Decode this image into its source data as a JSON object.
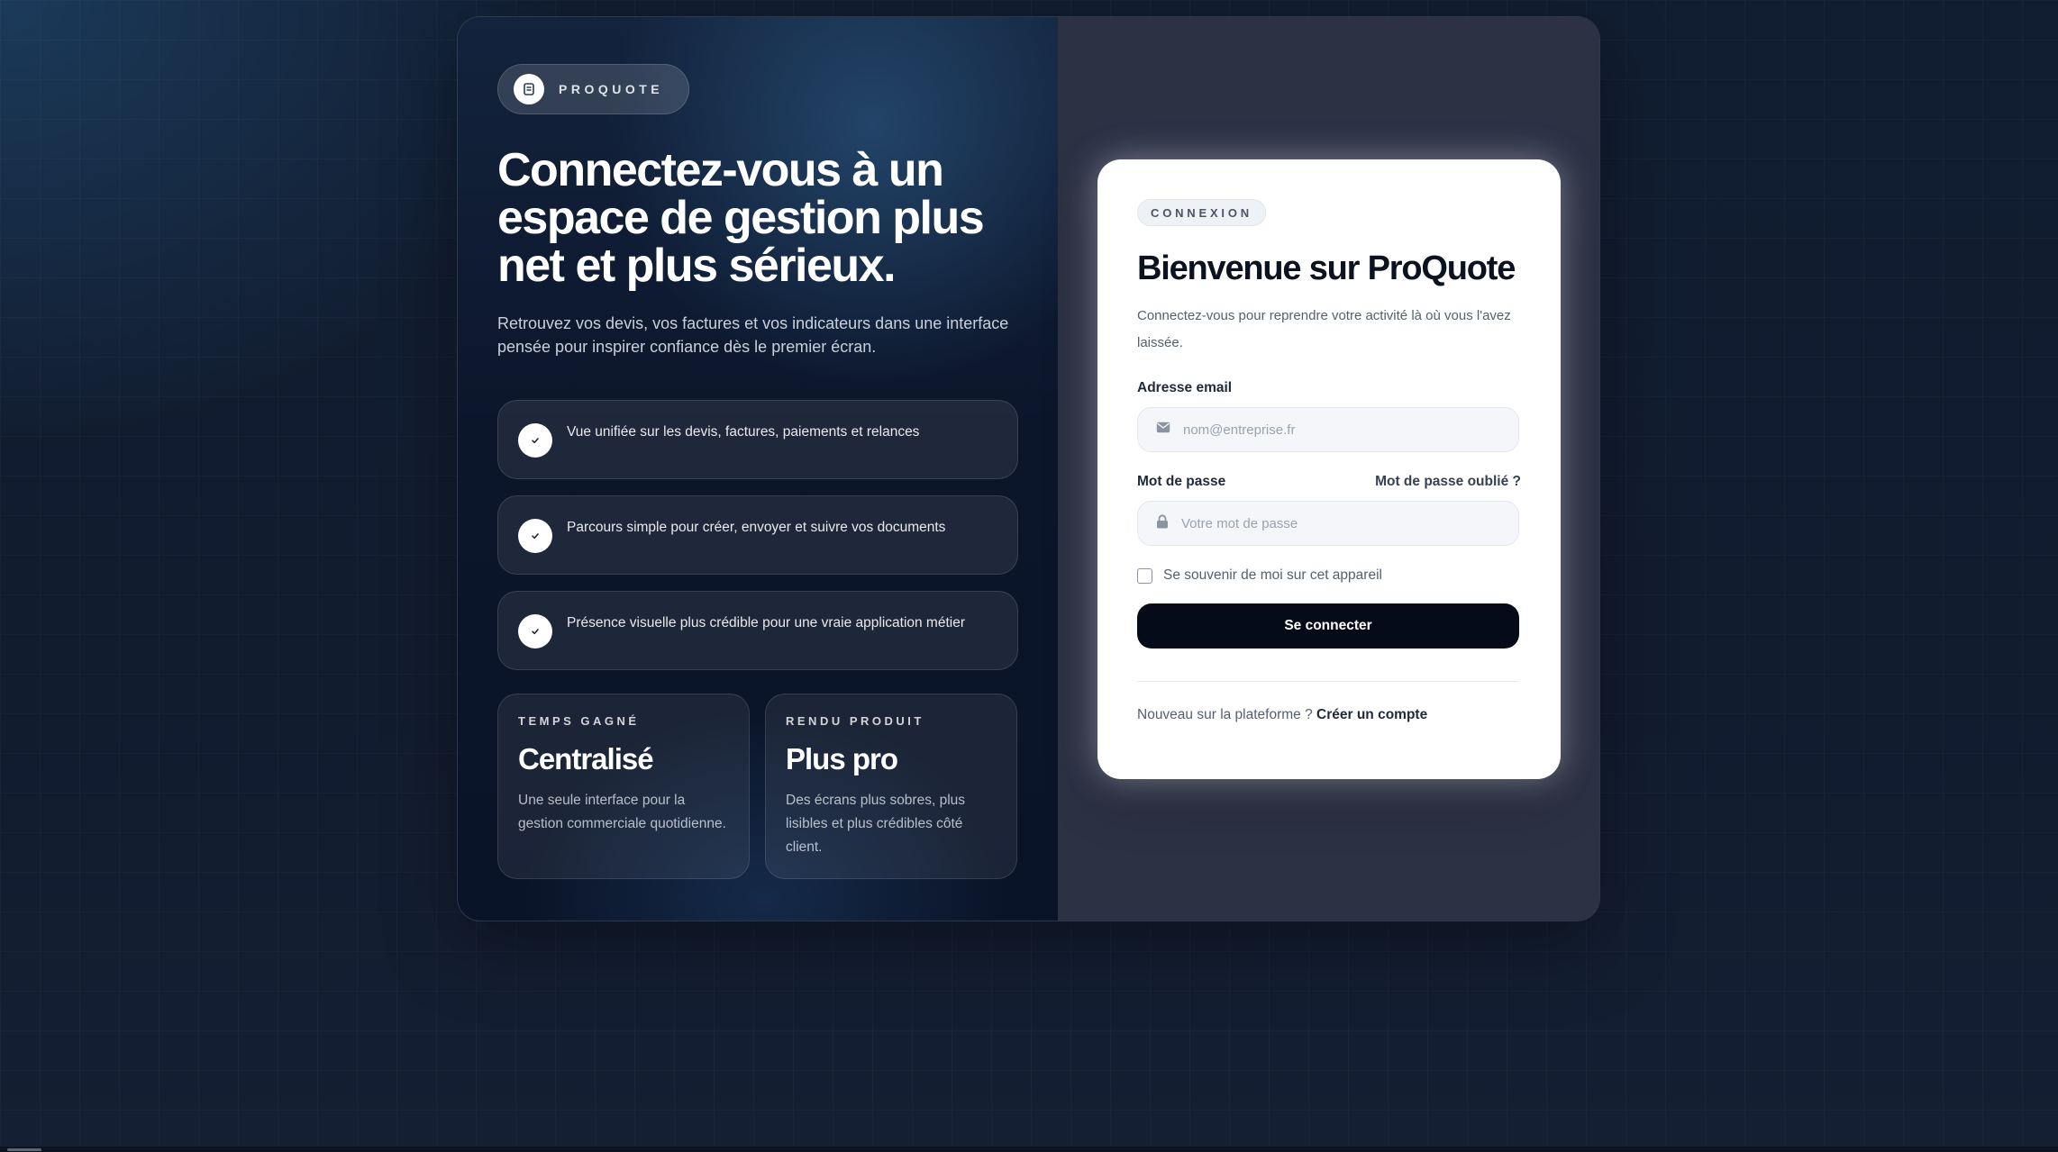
{
  "brand": {
    "name": "PROQUOTE",
    "icon": "document-icon"
  },
  "hero": {
    "title": "Connectez-vous à un espace de gestion plus net et plus sérieux.",
    "subtitle": "Retrouvez vos devis, vos factures et vos indicateurs dans une interface pensée pour inspirer confiance dès le premier écran."
  },
  "features": [
    {
      "text": "Vue unifiée sur les devis, factures, paiements et relances",
      "icon": "check-icon"
    },
    {
      "text": "Parcours simple pour créer, envoyer et suivre vos documents",
      "icon": "check-icon"
    },
    {
      "text": "Présence visuelle plus crédible pour une vraie application métier",
      "icon": "check-icon"
    }
  ],
  "stats": [
    {
      "kicker": "TEMPS GAGNÉ",
      "value": "Centralisé",
      "desc": "Une seule interface pour la gestion commerciale quotidienne."
    },
    {
      "kicker": "RENDU PRODUIT",
      "value": "Plus pro",
      "desc": "Des écrans plus sobres, plus lisibles et plus crédibles côté client."
    }
  ],
  "login": {
    "badge": "CONNEXION",
    "title": "Bienvenue sur ProQuote",
    "subtitle": "Connectez-vous pour reprendre votre activité là où vous l'avez laissée.",
    "email_label": "Adresse email",
    "email_placeholder": "nom@entreprise.fr",
    "email_value": "",
    "password_label": "Mot de passe",
    "forgot_label": "Mot de passe oublié ?",
    "password_placeholder": "Votre mot de passe",
    "password_value": "",
    "remember_label": "Se souvenir de moi sur cet appareil",
    "remember_checked": false,
    "submit_label": "Se connecter",
    "signup_prompt": "Nouveau sur la plateforme ?",
    "signup_link": "Créer un compte"
  },
  "colors": {
    "accent_dark": "#050b18",
    "panel_right": "#2c3144",
    "card_bg": "#ffffff",
    "page_bg": "#0f1a2e"
  }
}
